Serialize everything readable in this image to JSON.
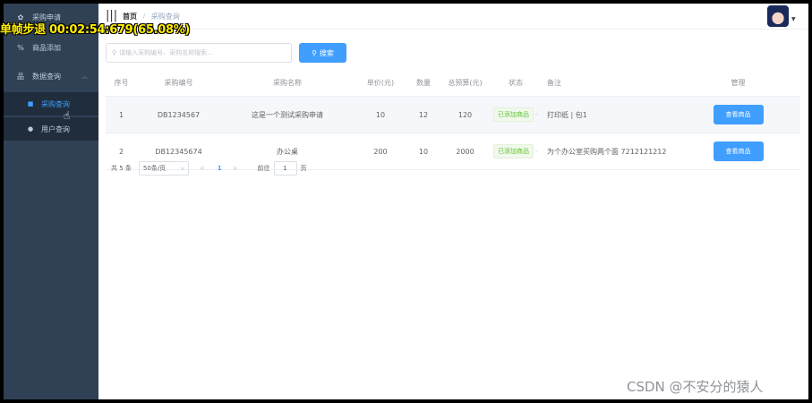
{
  "overlay": {
    "text": "单帧步退 00:02:54:679(65.08%)"
  },
  "sidebar": {
    "items": [
      {
        "label": "采购申请",
        "icon": "gear-icon"
      },
      {
        "label": "商品添加",
        "icon": "percent-icon"
      },
      {
        "label": "数据查询",
        "icon": "sitemap-icon"
      }
    ],
    "subitems": [
      {
        "label": "采购查询",
        "icon": "square-icon",
        "active": true
      },
      {
        "label": "用户查询",
        "icon": "user-icon",
        "active": false
      }
    ]
  },
  "navbar": {
    "breadcrumb_home": "首页",
    "breadcrumb_sep": "/",
    "breadcrumb_current": "采购查询"
  },
  "search": {
    "placeholder": "请输入采购编号、采购名称搜索...",
    "button_label": "搜索"
  },
  "table": {
    "headers": [
      "序号",
      "采购编号",
      "采购名称",
      "单价(元)",
      "数量",
      "总预算(元)",
      "状态",
      "备注",
      "管理"
    ],
    "rows": [
      {
        "index": "1",
        "code": "DB1234567",
        "name": "这是一个测试采购申请",
        "price": "10",
        "qty": "12",
        "total": "120",
        "status": "已添加商品",
        "note": "打印纸 | 包1",
        "action": "查看商品"
      },
      {
        "index": "2",
        "code": "DB12345674",
        "name": "办公桌",
        "price": "200",
        "qty": "10",
        "total": "2000",
        "status": "已添加商品",
        "note": "为个办公室买购两个面 7212121212",
        "action": "查看商品"
      }
    ]
  },
  "pagination": {
    "total": "共 5 条",
    "page_size": "50条/页",
    "current_page": "1",
    "goto_label": "前往",
    "goto_value": "1",
    "page_unit": "页"
  },
  "watermark": "CSDN @不安分的猿人",
  "colors": {
    "sidebar_bg": "#304156",
    "primary": "#409eff",
    "success": "#67c23a"
  }
}
